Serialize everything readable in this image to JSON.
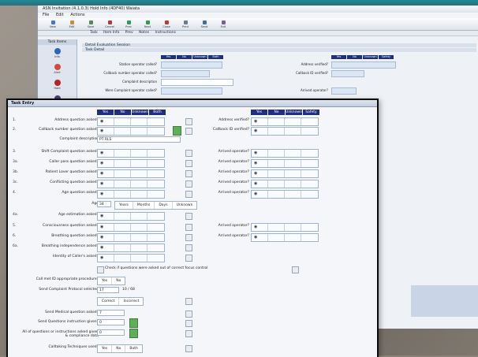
{
  "colors": {
    "header_navy": "#1e2f7e",
    "green_button": "#5fae5a",
    "field_border": "#9fb1cf",
    "teal_bar": "#1f8a96"
  },
  "back_window": {
    "title": "ASN Invitation (4.1.0.3)      Hold Info (4DF40) Waiata",
    "menu": [
      "File",
      "Edit",
      "Actions"
    ],
    "toolbar": [
      "New",
      "Edit",
      "Save",
      "Cancel",
      "Prev",
      "Next",
      "Close",
      "Print",
      "Send",
      "Exit"
    ],
    "tabs": [
      "Task",
      "Item Info",
      "Prev",
      "Notes",
      "Instructions"
    ],
    "side_header": "Task Items",
    "side_items": [
      "Info",
      "Alert",
      "Hold",
      "More"
    ],
    "section1": "Detail Evaluation Session",
    "section2": "Task Detail",
    "rows": [
      "Station operator called?",
      "Callback number operator called?",
      "Complaint description",
      "Were Complaint operator called?"
    ],
    "right_rows": [
      "Address verified?",
      "Callback ID verified?",
      "Arrived operator?"
    ],
    "head": [
      "Yes",
      "No",
      "Unknown",
      "Both"
    ],
    "right_head": [
      "Yes",
      "No",
      "Unknown",
      "Safety"
    ]
  },
  "front_window": {
    "title": "Task Entry",
    "head_left": [
      "Yes",
      "No",
      "Unknown",
      "Both"
    ],
    "head_right": [
      "Yes",
      "No",
      "Unknown",
      "Safety"
    ],
    "rows": [
      {
        "num": "1.",
        "label": "Address question asked?",
        "right_label": "Address verified?",
        "kind": "opts"
      },
      {
        "num": "2.",
        "label": "Callback number question asked?",
        "right_label": "Callback ID verified?",
        "kind": "opts_green"
      },
      {
        "num": "",
        "label": "Complaint description",
        "right_label": "",
        "kind": "text",
        "value": "PT RLS"
      },
      {
        "num": "3.",
        "label": "Shift Complaint question asked?",
        "right_label": "Arrived operator?",
        "kind": "opts"
      },
      {
        "num": "3a.",
        "label": "Caller pass question asked?",
        "right_label": "Arrived operator?",
        "kind": "opts"
      },
      {
        "num": "3b.",
        "label": "Patient Lover question asked?",
        "right_label": "Arrived operator?",
        "kind": "opts"
      },
      {
        "num": "3c.",
        "label": "Conflicting question asked?",
        "right_label": "Arrived operator?",
        "kind": "opts"
      },
      {
        "num": "4.",
        "label": "Age question asked?",
        "right_label": "Arrived operator?",
        "kind": "opts"
      },
      {
        "num": "",
        "label": "Age",
        "right_label": "",
        "kind": "age",
        "value": "34"
      },
      {
        "num": "4a.",
        "label": "Age estimation asked?",
        "right_label": "",
        "kind": "opts"
      },
      {
        "num": "5.",
        "label": "Consciousness question asked?",
        "right_label": "Arrived operator?",
        "kind": "opts"
      },
      {
        "num": "6.",
        "label": "Breathing question asked?",
        "right_label": "Arrived operator?",
        "kind": "opts"
      },
      {
        "num": "6a.",
        "label": "Breathing independence asked?",
        "right_label": "",
        "kind": "opts"
      },
      {
        "num": "",
        "label": "Identity of Caller's asked?",
        "right_label": "",
        "kind": "opts"
      }
    ],
    "age_units": [
      "Years",
      "Months",
      "Days",
      "Unknown"
    ],
    "check_text": "Check if questions were asked out of correct focus control",
    "compliance_label": "Call met ID appropriate procedure?",
    "compliance_opts": [
      "Yes",
      "No"
    ],
    "protocol_label": "Send Complaint Protocol selected",
    "protocol_value": "17",
    "protocol_suffix": "10 / 68",
    "correct_opts": [
      "Correct",
      "Incorrect"
    ],
    "bottom_rows": [
      {
        "label": "Send Medical question asked?",
        "value": "7"
      },
      {
        "label": "Send Questions instruction given?",
        "value": "0"
      },
      {
        "label": "All of questions or instructions asked given & compliance data",
        "value": "0"
      },
      {
        "label": "Calltaking Techniques used?",
        "value": ""
      }
    ],
    "last_opts": [
      "Yes",
      "No",
      "Both"
    ]
  }
}
